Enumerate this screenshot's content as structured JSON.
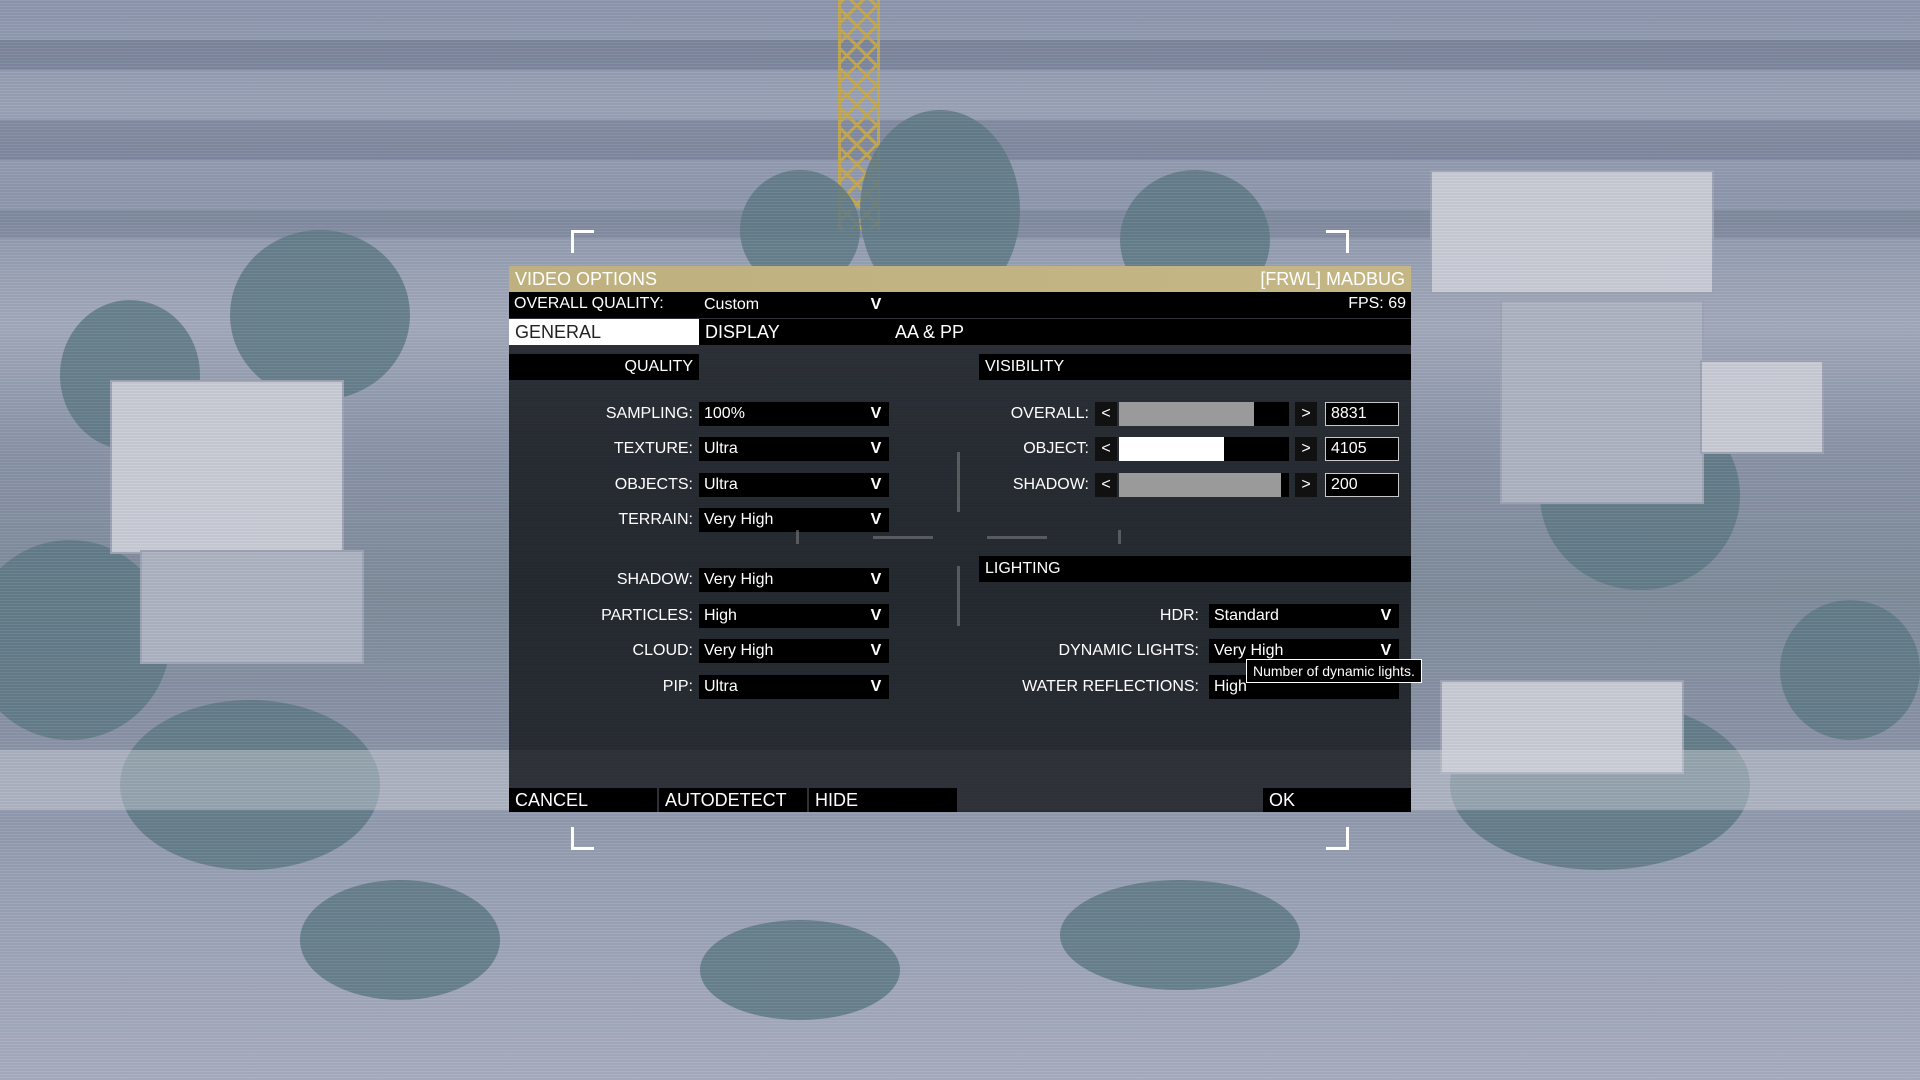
{
  "dialog": {
    "title": "VIDEO OPTIONS",
    "player": "[FRWL] MADBUG",
    "overall_quality_label": "OVERALL QUALITY:",
    "overall_quality_value": "Custom",
    "fps": "FPS: 69",
    "dropdown_arrow": "V"
  },
  "tabs": [
    {
      "label": "GENERAL",
      "active": true
    },
    {
      "label": "DISPLAY",
      "active": false
    },
    {
      "label": "AA & PP",
      "active": false
    }
  ],
  "quality": {
    "header": "QUALITY",
    "rows": [
      {
        "label": "SAMPLING:",
        "value": "100%"
      },
      {
        "label": "TEXTURE:",
        "value": "Ultra"
      },
      {
        "label": "OBJECTS:",
        "value": "Ultra"
      },
      {
        "label": "TERRAIN:",
        "value": "Very High"
      },
      {
        "label": "SHADOW:",
        "value": "Very High"
      },
      {
        "label": "PARTICLES:",
        "value": "High"
      },
      {
        "label": "CLOUD:",
        "value": "Very High"
      },
      {
        "label": "PIP:",
        "value": "Ultra"
      }
    ]
  },
  "visibility": {
    "header": "VISIBILITY",
    "dec_symbol": "<",
    "inc_symbol": ">",
    "rows": [
      {
        "label": "OVERALL:",
        "value": "8831",
        "fill_fraction": 0.88
      },
      {
        "label": "OBJECT:",
        "value": "4105",
        "fill_fraction": 0.73
      },
      {
        "label": "SHADOW:",
        "value": "200",
        "fill_fraction": 1.0
      }
    ]
  },
  "lighting": {
    "header": "LIGHTING",
    "rows": [
      {
        "label": "HDR:",
        "value": "Standard"
      },
      {
        "label": "DYNAMIC LIGHTS:",
        "value": "Very High"
      },
      {
        "label": "WATER REFLECTIONS:",
        "value": "High"
      }
    ],
    "tooltip": "Number of dynamic lights."
  },
  "buttons": {
    "cancel": "CANCEL",
    "autodetect": "AUTODETECT",
    "hide": "HIDE",
    "ok": "OK"
  },
  "colors": {
    "title_bar": "#c3b583",
    "panel": "#0c0e12",
    "active_tab": "#ffffff"
  }
}
